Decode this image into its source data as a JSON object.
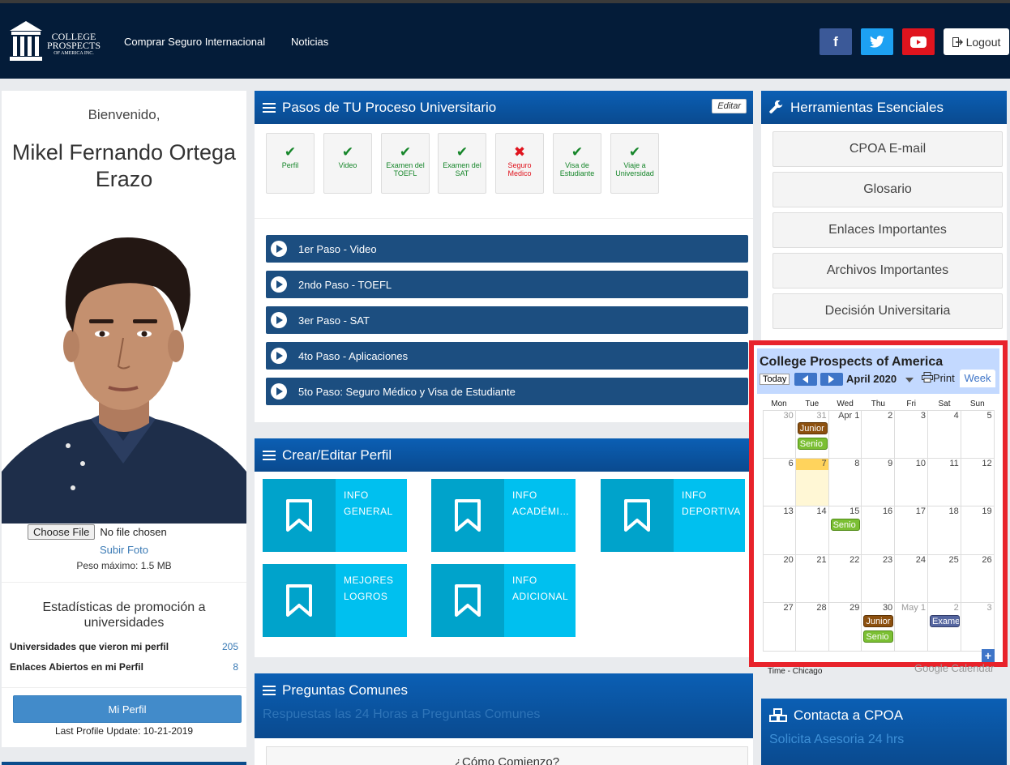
{
  "header": {
    "logo_line1": "COLLEGE",
    "logo_line2": "PROSPECTS",
    "logo_line3": "OF AMERICA INC.",
    "nav": [
      "Comprar Seguro Internacional",
      "Noticias"
    ],
    "social": [
      {
        "icon": "facebook-icon",
        "glyph": "f",
        "color": "#3b5998"
      },
      {
        "icon": "twitter-icon",
        "glyph": "t",
        "color": "#1da1f2"
      },
      {
        "icon": "youtube-icon",
        "glyph": "▶",
        "color": "#e0141e"
      }
    ],
    "logout_label": "Logout"
  },
  "profile": {
    "welcome": "Bienvenido,",
    "name": "Mikel Fernando Ortega Erazo",
    "choose_file": "Choose File",
    "no_file": "No file chosen",
    "upload_photo": "Subir Foto",
    "max_size": "Peso máximo: 1.5 MB",
    "stats_title": "Estadísticas de promoción a universidades",
    "stats": [
      {
        "label": "Universidades que vieron mi perfil",
        "value": "205"
      },
      {
        "label": "Enlaces Abiertos en mi Perfil",
        "value": "8"
      }
    ],
    "profile_button": "Mi Perfil",
    "last_update": "Last Profile Update: 10-21-2019"
  },
  "steps_panel": {
    "title": "Pasos de TU Proceso Universitario",
    "edit_label": "Editar",
    "checklist": [
      {
        "label": "Perfil",
        "status": "ok",
        "mark": "✔"
      },
      {
        "label": "Video",
        "status": "ok",
        "mark": "✔"
      },
      {
        "label": "Examen del TOEFL",
        "status": "ok",
        "mark": "✔"
      },
      {
        "label": "Examen del SAT",
        "status": "ok",
        "mark": "✔"
      },
      {
        "label": "Seguro Medico",
        "status": "bad",
        "mark": "✖"
      },
      {
        "label": "Visa de Estudiante",
        "status": "ok",
        "mark": "✔"
      },
      {
        "label": "Viaje a Universidad",
        "status": "ok",
        "mark": "✔"
      }
    ],
    "steps": [
      "1er Paso - Video",
      "2ndo Paso - TOEFL",
      "3er Paso - SAT",
      "4to Paso - Aplicaciones",
      "5to Paso: Seguro Médico y Visa de Estudiante"
    ]
  },
  "profile_panel": {
    "title": "Crear/Editar Perfil",
    "tiles": [
      {
        "line1": "INFO",
        "line2": "GENERAL"
      },
      {
        "line1": "INFO",
        "line2": "ACADÉMI…"
      },
      {
        "line1": "INFO",
        "line2": "DEPORTIVA"
      },
      {
        "line1": "MEJORES",
        "line2": "LOGROS"
      },
      {
        "line1": "INFO",
        "line2": "ADICIONAL"
      }
    ]
  },
  "faq_panel": {
    "title": "Preguntas Comunes",
    "subtitle": "Respuestas las 24 Horas a Preguntas Comunes",
    "first_item": "¿Cómo Comienzo?"
  },
  "tools_panel": {
    "title": "Herramientas Esenciales",
    "buttons": [
      "CPOA E-mail",
      "Glosario",
      "Enlaces Importantes",
      "Archivos Importantes",
      "Decisión Universitaria"
    ]
  },
  "contact_panel": {
    "title": "Contacta a CPOA",
    "subtitle": "Solicita Asesoria 24 hrs"
  },
  "calendar": {
    "title": "College Prospects of America",
    "today_label": "Today",
    "month_label": "April 2020",
    "print_label": "Print",
    "view_label": "Week",
    "days_of_week": [
      "Mon",
      "Tue",
      "Wed",
      "Thu",
      "Fri",
      "Sat",
      "Sun"
    ],
    "weeks": [
      [
        "30",
        "31",
        "Apr 1",
        "2",
        "3",
        "4",
        "5"
      ],
      [
        "6",
        "7",
        "8",
        "9",
        "10",
        "11",
        "12"
      ],
      [
        "13",
        "14",
        "15",
        "16",
        "17",
        "18",
        "19"
      ],
      [
        "20",
        "21",
        "22",
        "23",
        "24",
        "25",
        "26"
      ],
      [
        "27",
        "28",
        "29",
        "30",
        "May 1",
        "2",
        "3"
      ]
    ],
    "events": [
      {
        "week": 0,
        "day": 1,
        "slot": 0,
        "label": "Junior",
        "kind": "jun"
      },
      {
        "week": 0,
        "day": 1,
        "slot": 1,
        "label": "Senio",
        "kind": "sen"
      },
      {
        "week": 2,
        "day": 2,
        "slot": 0,
        "label": "Senio",
        "kind": "sen"
      },
      {
        "week": 4,
        "day": 3,
        "slot": 0,
        "label": "Junior",
        "kind": "jun"
      },
      {
        "week": 4,
        "day": 3,
        "slot": 1,
        "label": "Senio",
        "kind": "sen"
      },
      {
        "week": 4,
        "day": 5,
        "slot": 0,
        "label": "Exame",
        "kind": "exa"
      }
    ],
    "timezone": "Time - Chicago",
    "google_label": "Google Calendar"
  }
}
